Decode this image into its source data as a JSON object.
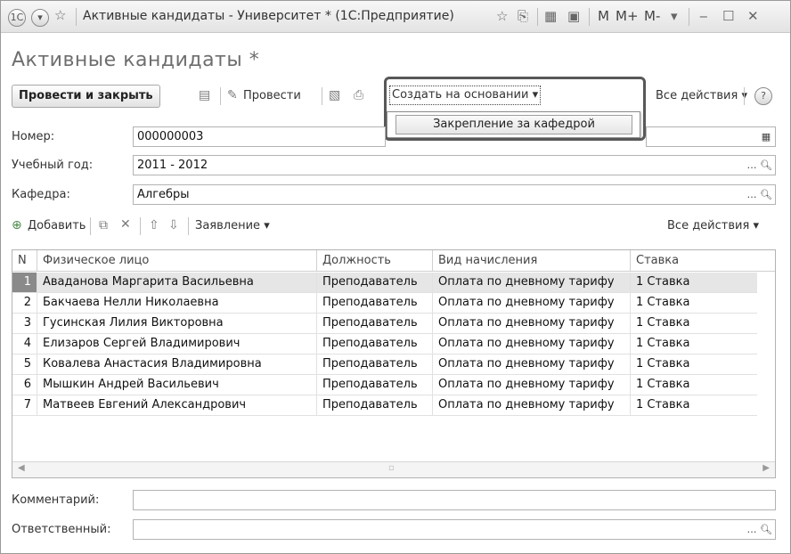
{
  "window": {
    "title": "Активные кандидаты - Университет * (1С:Предприятие)",
    "toolbar_letters": [
      "M",
      "M+",
      "M-"
    ]
  },
  "form": {
    "title": "Активные кандидаты *",
    "post_and_close": "Провести и закрыть",
    "post": "Провести",
    "create_based_on": "Создать на основании",
    "dropdown_item": "Закрепление за кафедрой",
    "all_actions": "Все действия",
    "help": "?"
  },
  "fields": {
    "number_label": "Номер:",
    "number_value": "000000003",
    "year_label": "Учебный год:",
    "year_value": "2011 - 2012",
    "dept_label": "Кафедра:",
    "dept_value": "Алгебры",
    "comment_label": "Комментарий:",
    "comment_value": "",
    "resp_label": "Ответственный:",
    "resp_value": ""
  },
  "table_toolbar": {
    "add": "Добавить",
    "application": "Заявление",
    "all_actions": "Все действия"
  },
  "table": {
    "columns": [
      "N",
      "Физическое лицо",
      "Должность",
      "Вид начисления",
      "Ставка"
    ],
    "rows": [
      {
        "n": "1",
        "person": "Аваданова Маргарита Васильевна",
        "position": "Преподаватель",
        "accrual": "Оплата по дневному тарифу",
        "rate": "1 Ставка"
      },
      {
        "n": "2",
        "person": "Бакчаева Нелли Николаевна",
        "position": "Преподаватель",
        "accrual": "Оплата по дневному тарифу",
        "rate": "1 Ставка"
      },
      {
        "n": "3",
        "person": "Гусинская Лилия Викторовна",
        "position": "Преподаватель",
        "accrual": "Оплата по дневному тарифу",
        "rate": "1 Ставка"
      },
      {
        "n": "4",
        "person": "Елизаров Сергей Владимирович",
        "position": "Преподаватель",
        "accrual": "Оплата по дневному тарифу",
        "rate": "1 Ставка"
      },
      {
        "n": "5",
        "person": "Ковалева Анастасия Владимировна",
        "position": "Преподаватель",
        "accrual": "Оплата по дневному тарифу",
        "rate": "1 Ставка"
      },
      {
        "n": "6",
        "person": "Мышкин Андрей Васильевич",
        "position": "Преподаватель",
        "accrual": "Оплата по дневному тарифу",
        "rate": "1 Ставка"
      },
      {
        "n": "7",
        "person": "Матвеев Евгений Александрович",
        "position": "Преподаватель",
        "accrual": "Оплата по дневному тарифу",
        "rate": "1 Ставка"
      }
    ]
  },
  "colors": {
    "selected_row": "#e6e6e6",
    "highlight_frame": "#585858"
  }
}
